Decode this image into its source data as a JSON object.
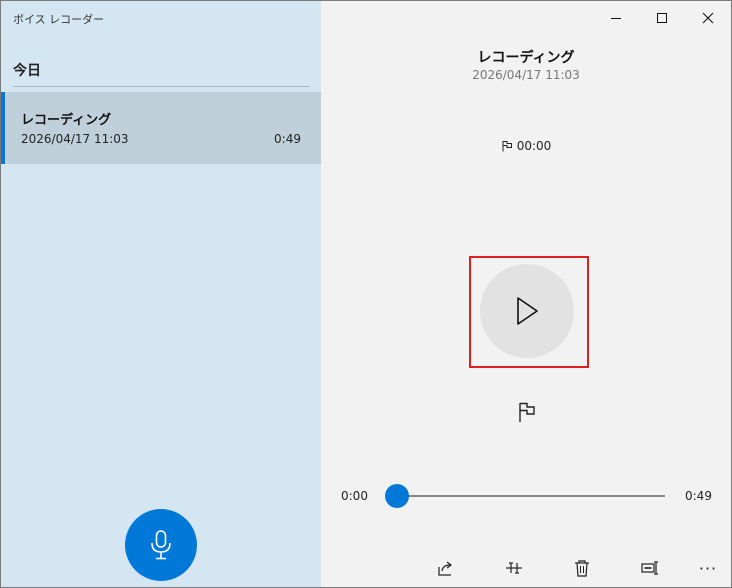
{
  "app": {
    "title": "ボイス レコーダー"
  },
  "list": {
    "section_header": "今日",
    "items": [
      {
        "name": "レコーディング",
        "date": "2026/04/17 11:03",
        "duration": "0:49"
      }
    ]
  },
  "player": {
    "title": "レコーディング",
    "datetime": "2026/04/17 11:03",
    "marker_time": "00:00",
    "current_time": "0:00",
    "total_time": "0:49",
    "progress_fraction": 0.0
  },
  "icons": {
    "mic": "microphone-icon",
    "play": "play-icon",
    "flag": "flag-icon",
    "share": "share-icon",
    "trim": "trim-icon",
    "delete": "delete-icon",
    "rename": "rename-icon",
    "more": "more-icon"
  },
  "toolbar": {
    "more_label": "···"
  },
  "colors": {
    "accent": "#0078d7",
    "left_pane_bg": "#d4e6f1",
    "selected_item_bg": "#c0d0da",
    "right_pane_bg": "#f2f2f2",
    "highlight": "#e02020"
  }
}
